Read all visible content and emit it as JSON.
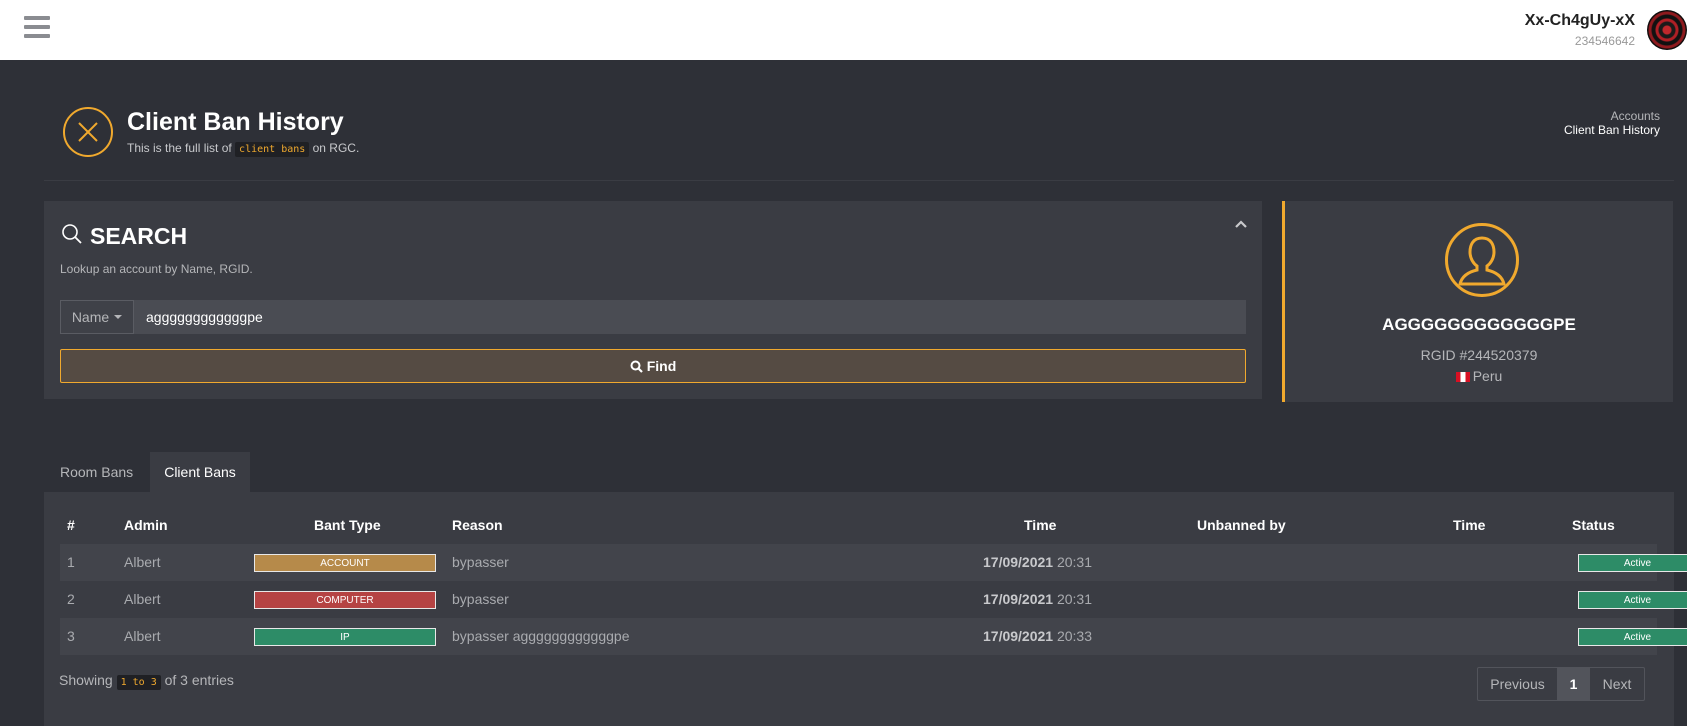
{
  "topbar": {
    "user_name": "Xx-Ch4gUy-xX",
    "user_id": "234546642"
  },
  "page": {
    "title": "Client Ban History",
    "subtitle_prefix": "This is the full list of",
    "subtitle_code": "client bans",
    "subtitle_suffix": "on RGC.",
    "breadcrumb": [
      "Accounts",
      "Client Ban History"
    ]
  },
  "search": {
    "title": "SEARCH",
    "help": "Lookup an account by Name, RGID.",
    "select_label": "Name",
    "input_value": "aggggggggggggpe",
    "find_label": "Find"
  },
  "profile": {
    "name": "AGGGGGGGGGGGGPE",
    "rgid": "RGID #244520379",
    "country": "Peru"
  },
  "tabs": [
    {
      "label": "Room Bans",
      "active": false
    },
    {
      "label": "Client Bans",
      "active": true
    }
  ],
  "table": {
    "headers": [
      "#",
      "Admin",
      "Bant Type",
      "Reason",
      "Time",
      "Unbanned by",
      "Time",
      "Status"
    ],
    "rows": [
      {
        "num": "1",
        "admin": "Albert",
        "type": "ACCOUNT",
        "reason": "bypasser",
        "date": "17/09/2021",
        "time": "20:31",
        "unbanned_by": "",
        "unban_time": "",
        "status": "Active"
      },
      {
        "num": "2",
        "admin": "Albert",
        "type": "COMPUTER",
        "reason": "bypasser",
        "date": "17/09/2021",
        "time": "20:31",
        "unbanned_by": "",
        "unban_time": "",
        "status": "Active"
      },
      {
        "num": "3",
        "admin": "Albert",
        "type": "IP",
        "reason": "bypasser aggggggggggggpe",
        "date": "17/09/2021",
        "time": "20:33",
        "unbanned_by": "",
        "unban_time": "",
        "status": "Active"
      }
    ],
    "info_prefix": "Showing",
    "info_range": "1 to 3",
    "info_suffix": "of 3 entries",
    "pagination": {
      "previous": "Previous",
      "current": "1",
      "next": "Next"
    }
  },
  "colors": {
    "accent": "#f0a92e",
    "background": "#2e3037",
    "card": "#3a3c43",
    "account_badge": "#b68a4a",
    "computer_badge": "#b54343",
    "ip_badge": "#2d8c67",
    "active_badge": "#2d8c67"
  }
}
